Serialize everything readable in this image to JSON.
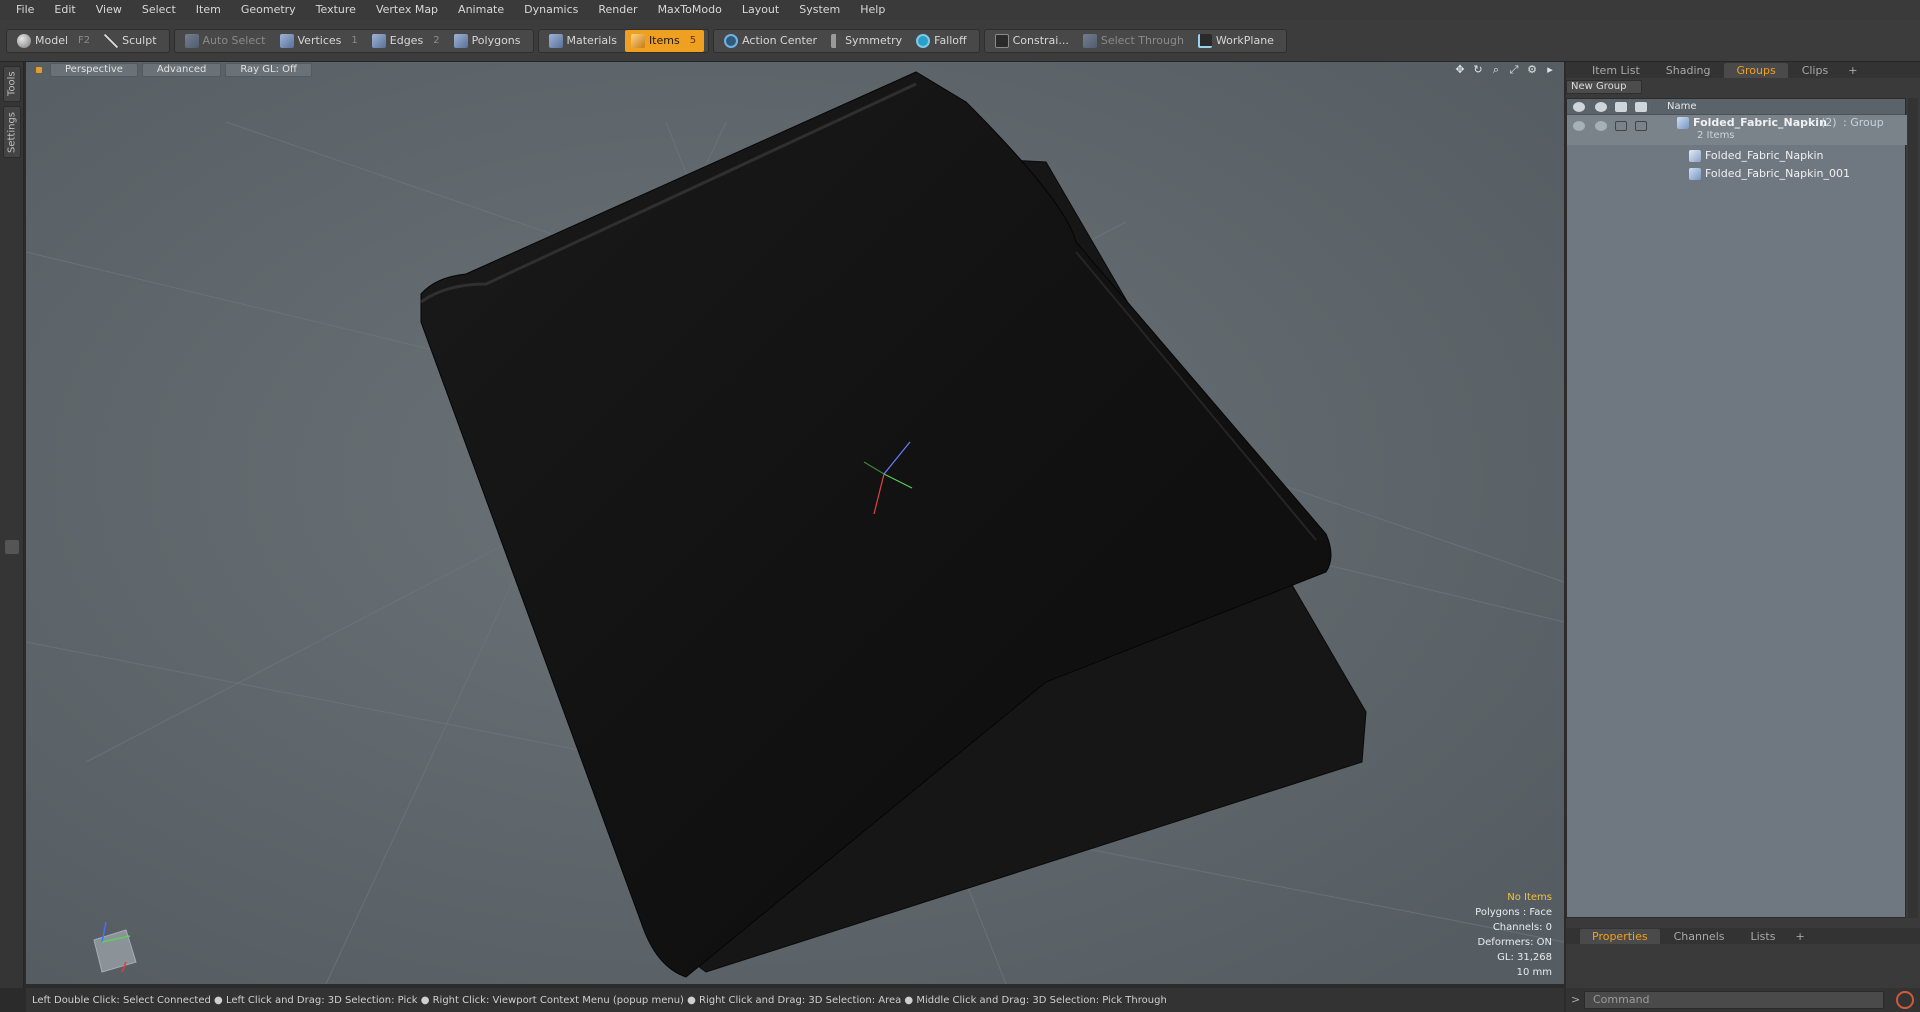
{
  "menu": [
    "File",
    "Edit",
    "View",
    "Select",
    "Item",
    "Geometry",
    "Texture",
    "Vertex Map",
    "Animate",
    "Dynamics",
    "Render",
    "MaxToModo",
    "Layout",
    "System",
    "Help"
  ],
  "toolbar": {
    "model": "Model",
    "model_key": "F2",
    "sculpt": "Sculpt",
    "auto_select": "Auto Select",
    "vertices": "Vertices",
    "vertices_key": "1",
    "edges": "Edges",
    "edges_key": "2",
    "polygons": "Polygons",
    "materials": "Materials",
    "items": "Items",
    "items_key": "5",
    "action_center": "Action Center",
    "symmetry": "Symmetry",
    "falloff": "Falloff",
    "constraints": "Constrai...",
    "select_through": "Select Through",
    "workplane": "WorkPlane"
  },
  "left_tabs": {
    "tools": "Tools",
    "settings": "Settings"
  },
  "viewport": {
    "perspective": "Perspective",
    "advanced": "Advanced",
    "raygl": "Ray GL: Off",
    "info": {
      "no_items": "No Items",
      "polygons": "Polygons : Face",
      "channels": "Channels: 0",
      "deformers": "Deformers: ON",
      "gl": "GL: 31,268",
      "scale": "10 mm"
    }
  },
  "right_panel": {
    "tabs": [
      "Item List",
      "Shading",
      "Groups",
      "Clips"
    ],
    "active_tab": "Groups",
    "new_group": "New Group",
    "column_name": "Name",
    "group": {
      "name": "Folded_Fabric_Napkin",
      "count": "(2)",
      "type": ": Group",
      "items": "2 Items"
    },
    "children": [
      "Folded_Fabric_Napkin",
      "Folded_Fabric_Napkin_001"
    ],
    "bottom_tabs": [
      "Properties",
      "Channels",
      "Lists"
    ]
  },
  "status_bar": "Left Double Click: Select Connected ● Left Click and Drag: 3D Selection: Pick ● Right Click: Viewport Context Menu (popup menu) ● Right Click and Drag: 3D Selection: Area ● Middle Click and Drag: 3D Selection: Pick Through",
  "command_placeholder": "Command"
}
